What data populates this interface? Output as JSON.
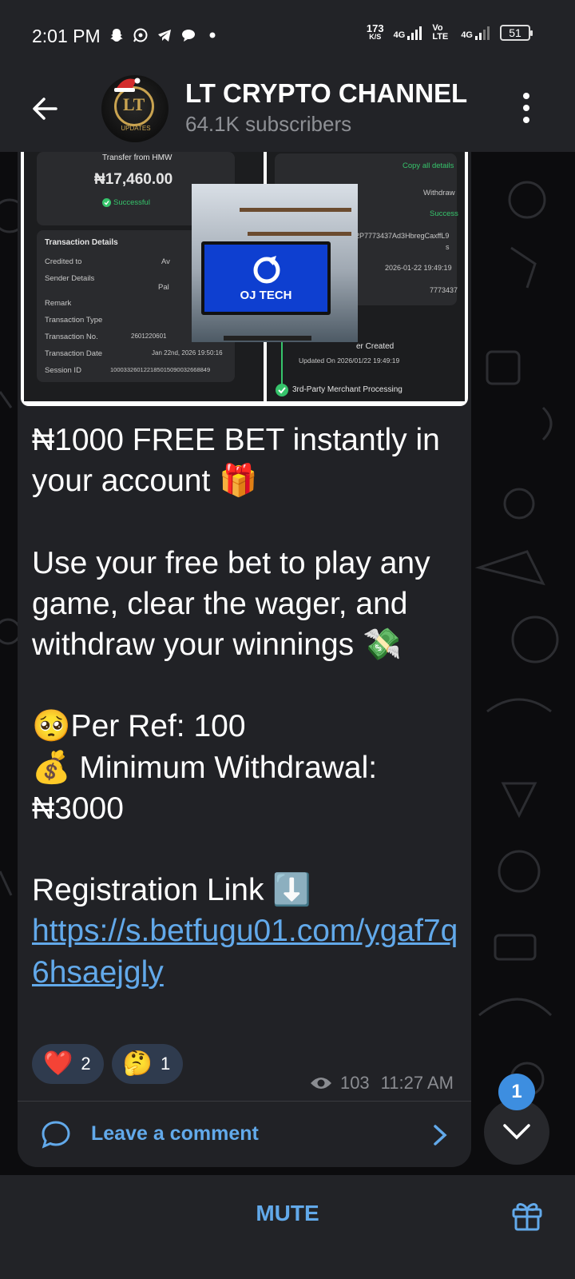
{
  "status_bar": {
    "time": "2:01 PM",
    "net_speed_value": "173",
    "net_speed_unit": "K/S",
    "network_1": "4G",
    "volte": "Vo LTE",
    "network_2": "4G",
    "battery": "51",
    "icons": [
      "snapchat-icon",
      "whatsapp-icon",
      "telegram-icon",
      "chat-icon",
      "dot-icon"
    ]
  },
  "header": {
    "title": "LT CRYPTO CHANNEL",
    "subtitle": "64.1K subscribers",
    "avatar_text": "LT",
    "avatar_caption": "UPDATES"
  },
  "media": {
    "left_card": {
      "heading": "Transfer from HMW",
      "amount": "₦17,460.00",
      "status": "Successful",
      "section_title": "Transaction Details",
      "rows": [
        {
          "label": "Credited to",
          "value": "Av"
        },
        {
          "label": "Sender Details",
          "value": "Pal"
        },
        {
          "label": "Remark",
          "value": ""
        },
        {
          "label": "Transaction Type",
          "value": ""
        },
        {
          "label": "Transaction No.",
          "value": "2601220601"
        },
        {
          "label": "Transaction Date",
          "value": "Jan 22nd, 2026 19:50:16"
        },
        {
          "label": "Session ID",
          "value": "100033260122185015090032668849"
        }
      ]
    },
    "right_card": {
      "copy_label": "Copy all details",
      "type": "Withdraw",
      "status": "Success",
      "ref": "02P7773437Ad3HbregCaxffL9",
      "ref_tail": "s",
      "datetime": "2026-01-22 19:49:19",
      "id": "7773437",
      "step1": "er Created",
      "step1_sub": "Updated On 2026/01/22 19:49:19",
      "step2": "3rd-Party Merchant Processing"
    },
    "overlay_logo": "OJ TECH"
  },
  "message": {
    "line1": "₦1000 FREE BET instantly in your account 🎁",
    "line2": "Use your free bet to play any game, clear the wager, and withdraw your winnings 💸",
    "line3": "🥺Per Ref: 100",
    "line4": "💰 Minimum Withdrawal: ₦3000",
    "line5": "Registration Link ⬇️",
    "link": "https://s.betfugu01.com/ygaf7q6hsaejgly"
  },
  "reactions": [
    {
      "emoji": "❤️",
      "count": "2"
    },
    {
      "emoji": "🤔",
      "count": "1"
    }
  ],
  "meta": {
    "views": "103",
    "time": "11:27 AM"
  },
  "comment": {
    "label": "Leave a comment"
  },
  "scroll": {
    "badge": "1"
  },
  "bottom": {
    "mute_label": "MUTE"
  },
  "colors": {
    "accent": "#62a9ea",
    "bubble": "#212226",
    "bar": "#222327",
    "success": "#36c46b"
  }
}
